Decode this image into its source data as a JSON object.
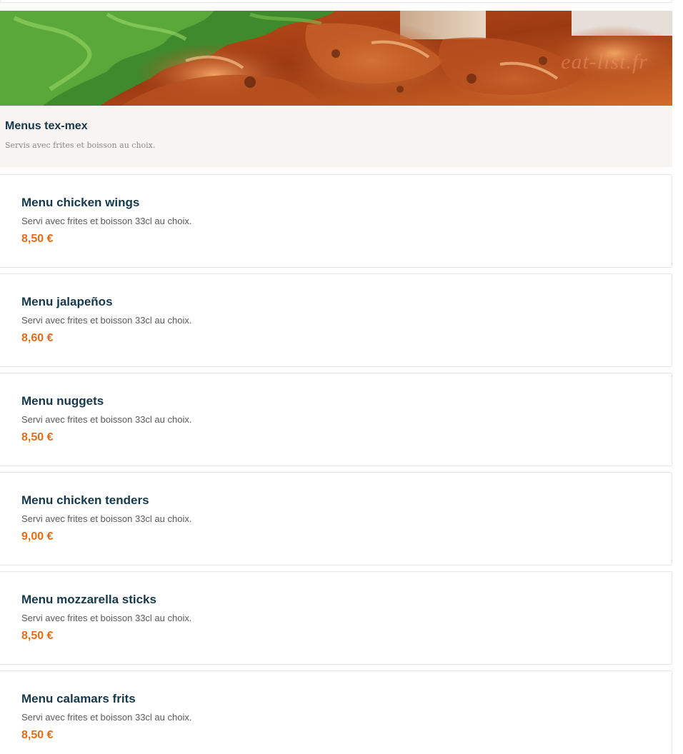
{
  "category": {
    "title": "Menus tex-mex",
    "subtitle": "Servis avec frites et boisson au choix.",
    "banner_watermark": "eat-list.fr"
  },
  "items": [
    {
      "name": "Menu chicken wings",
      "description": "Servi avec frites et boisson 33cl au choix.",
      "price": "8,50 €"
    },
    {
      "name": "Menu jalapeños",
      "description": "Servi avec frites et boisson 33cl au choix.",
      "price": "8,60 €"
    },
    {
      "name": "Menu nuggets",
      "description": "Servi avec frites et boisson 33cl au choix.",
      "price": "8,50 €"
    },
    {
      "name": "Menu chicken tenders",
      "description": "Servi avec frites et boisson 33cl au choix.",
      "price": "9,00 €"
    },
    {
      "name": "Menu mozzarella sticks",
      "description": "Servi avec frites et boisson 33cl au choix.",
      "price": "8,50 €"
    },
    {
      "name": "Menu calamars frits",
      "description": "Servi avec frites et boisson 33cl au choix.",
      "price": "8,50 €"
    }
  ],
  "colors": {
    "title": "#15394b",
    "price": "#e36d17",
    "category_bg": "#f8f4f1"
  }
}
